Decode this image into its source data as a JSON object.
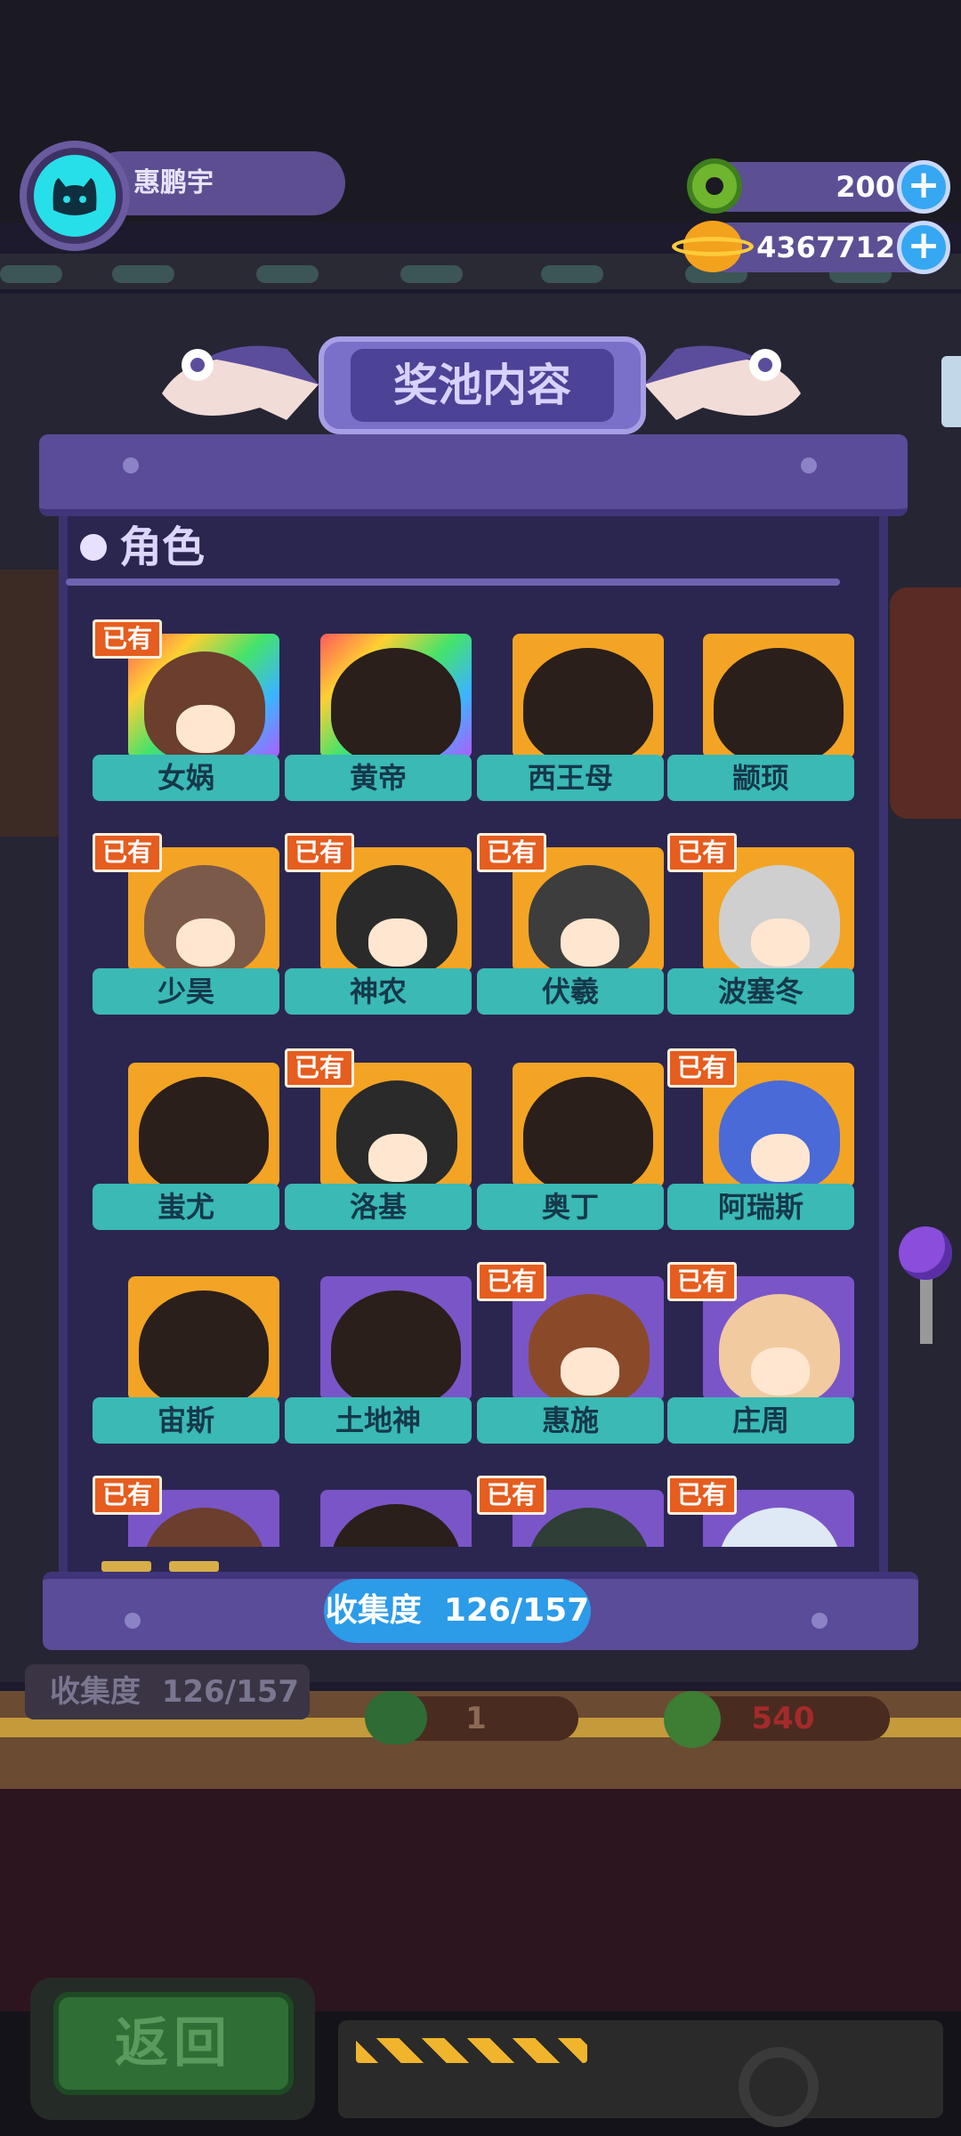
{
  "player": {
    "name": "惠鹏宇",
    "avatar_icon": "cat-face-icon"
  },
  "currencies": [
    {
      "icon": "green-donut-icon",
      "value": "200"
    },
    {
      "icon": "golden-planet-icon",
      "value": "4367712"
    }
  ],
  "panel": {
    "title": "奖池内容",
    "section_title": "角色",
    "owned_label": "已有",
    "collection": {
      "label": "收集度",
      "value": "126/157"
    }
  },
  "characters": [
    {
      "name": "女娲",
      "owned": true,
      "frame": "rainbow"
    },
    {
      "name": "黄帝",
      "owned": false,
      "frame": "rainbow"
    },
    {
      "name": "西王母",
      "owned": false,
      "frame": "gold"
    },
    {
      "name": "颛顼",
      "owned": false,
      "frame": "gold"
    },
    {
      "name": "少昊",
      "owned": true,
      "frame": "gold"
    },
    {
      "name": "神农",
      "owned": true,
      "frame": "gold"
    },
    {
      "name": "伏羲",
      "owned": true,
      "frame": "gold"
    },
    {
      "name": "波塞冬",
      "owned": true,
      "frame": "gold"
    },
    {
      "name": "蚩尤",
      "owned": false,
      "frame": "gold"
    },
    {
      "name": "洛基",
      "owned": true,
      "frame": "gold"
    },
    {
      "name": "奥丁",
      "owned": false,
      "frame": "gold"
    },
    {
      "name": "阿瑞斯",
      "owned": true,
      "frame": "gold"
    },
    {
      "name": "宙斯",
      "owned": false,
      "frame": "gold"
    },
    {
      "name": "土地神",
      "owned": false,
      "frame": "purple"
    },
    {
      "name": "惠施",
      "owned": true,
      "frame": "purple"
    },
    {
      "name": "庄周",
      "owned": true,
      "frame": "purple"
    },
    {
      "name": "",
      "owned": true,
      "frame": "purple"
    },
    {
      "name": "",
      "owned": false,
      "frame": "purple"
    },
    {
      "name": "",
      "owned": true,
      "frame": "purple"
    },
    {
      "name": "",
      "owned": true,
      "frame": "purple"
    }
  ],
  "background": {
    "collect_label": "收集度",
    "collect_value": "126/157",
    "pill1_value": "1",
    "pill2_value": "540"
  },
  "back_button": {
    "label": "返回"
  },
  "colors": {
    "panel": "#5a4c98",
    "panel_body": "#2b2650",
    "name_ribbon": "#3ab9b5",
    "owned_tag": "#e55d1f",
    "collect_pill": "#2c9be8"
  }
}
